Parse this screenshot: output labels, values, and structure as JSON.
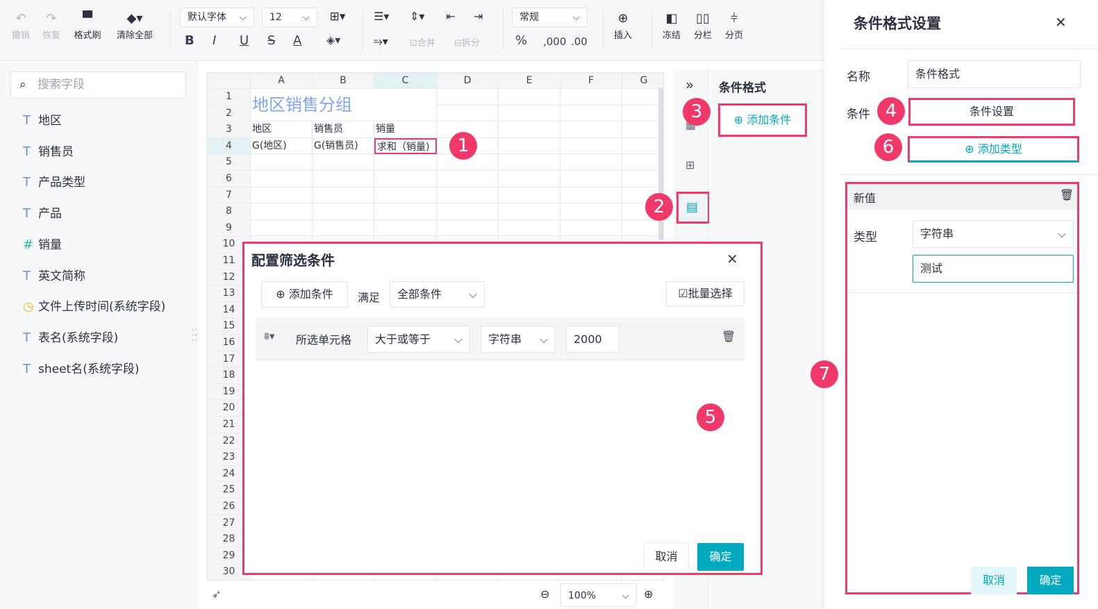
{
  "toolbar": {
    "undo": "撤销",
    "redo": "恢复",
    "format_painter": "格式刷",
    "clear_all": "清除全部",
    "font": "默认字体",
    "font_size": "12",
    "bold": "B",
    "italic": "I",
    "underline": "U",
    "strike": "S",
    "font_color": "A",
    "merge": "合并",
    "split": "拆分",
    "number_format": "常规",
    "percent": "%",
    "thousands": ",000",
    "decimal": ".00",
    "insert": "插入",
    "freeze": "冻结",
    "columns": "分栏",
    "pagination": "分页"
  },
  "sidebar": {
    "search_placeholder": "搜索字段",
    "fields": [
      {
        "icon": "T",
        "label": "地区"
      },
      {
        "icon": "T",
        "label": "销售员"
      },
      {
        "icon": "T",
        "label": "产品类型"
      },
      {
        "icon": "T",
        "label": "产品"
      },
      {
        "icon": "#",
        "label": "销量"
      },
      {
        "icon": "T",
        "label": "英文简称"
      },
      {
        "icon": "clock",
        "label": "文件上传时间(系统字段)"
      },
      {
        "icon": "T",
        "label": "表名(系统字段)"
      },
      {
        "icon": "T",
        "label": "sheet名(系统字段)"
      }
    ]
  },
  "sheet": {
    "columns": [
      "A",
      "B",
      "C",
      "D",
      "E",
      "F",
      "G"
    ],
    "title": "地区销售分组",
    "row3": [
      "地区",
      "销售员",
      "销量"
    ],
    "row4": [
      "G(地区)",
      "G(销售员)",
      "求和（销量)"
    ],
    "rows": [
      "1",
      "2",
      "3",
      "4",
      "5",
      "6",
      "7",
      "8",
      "9",
      "10",
      "11",
      "12",
      "13",
      "14",
      "15",
      "16",
      "17",
      "18",
      "19",
      "20",
      "21",
      "22",
      "23",
      "24",
      "25",
      "26",
      "27",
      "28",
      "29",
      "30"
    ],
    "zoom": "100%"
  },
  "cf_panel": {
    "title": "条件格式",
    "add_condition": "添加条件"
  },
  "dialog": {
    "title": "配置筛选条件",
    "add_condition": "添加条件",
    "satisfy_label": "满足",
    "satisfy_value": "全部条件",
    "batch_select": "批量选择",
    "condition": {
      "field": "所选单元格",
      "operator": "大于或等于",
      "type": "字符串",
      "value": "2000"
    },
    "cancel": "取消",
    "ok": "确定"
  },
  "drawer": {
    "title": "条件格式设置",
    "name_label": "名称",
    "name_value": "条件格式",
    "condition_label": "条件",
    "condition_button": "条件设置",
    "add_type": "添加类型",
    "section_title": "新值",
    "type_label": "类型",
    "type_value": "字符串",
    "value": "测试",
    "cancel": "取消",
    "ok": "确定"
  },
  "badges": [
    "1",
    "2",
    "3",
    "4",
    "5",
    "6",
    "7"
  ],
  "colors": {
    "accent": "#00a9bd",
    "highlight": "#f0386b",
    "title_blue": "#7fa6f2"
  }
}
